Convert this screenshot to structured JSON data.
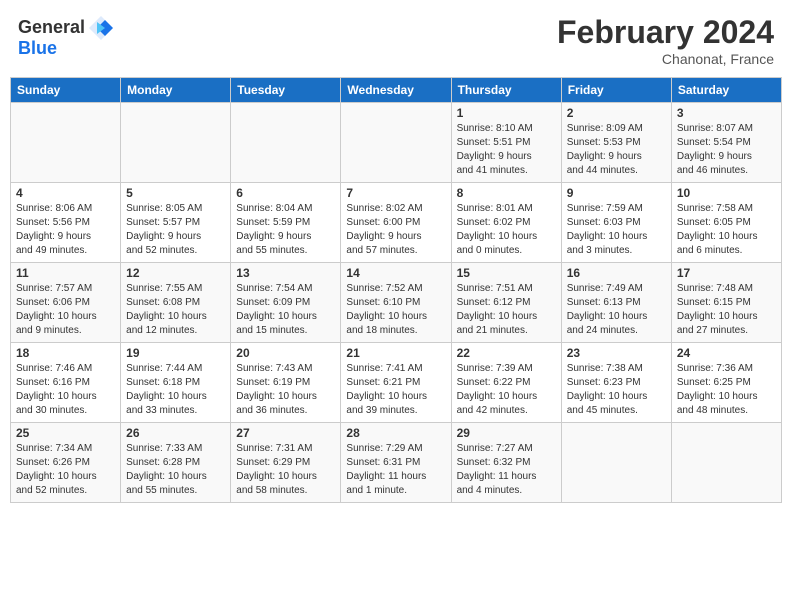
{
  "header": {
    "logo_line1": "General",
    "logo_line2": "Blue",
    "month_title": "February 2024",
    "location": "Chanonat, France"
  },
  "days_of_week": [
    "Sunday",
    "Monday",
    "Tuesday",
    "Wednesday",
    "Thursday",
    "Friday",
    "Saturday"
  ],
  "weeks": [
    [
      {
        "day": "",
        "info": ""
      },
      {
        "day": "",
        "info": ""
      },
      {
        "day": "",
        "info": ""
      },
      {
        "day": "",
        "info": ""
      },
      {
        "day": "1",
        "info": "Sunrise: 8:10 AM\nSunset: 5:51 PM\nDaylight: 9 hours\nand 41 minutes."
      },
      {
        "day": "2",
        "info": "Sunrise: 8:09 AM\nSunset: 5:53 PM\nDaylight: 9 hours\nand 44 minutes."
      },
      {
        "day": "3",
        "info": "Sunrise: 8:07 AM\nSunset: 5:54 PM\nDaylight: 9 hours\nand 46 minutes."
      }
    ],
    [
      {
        "day": "4",
        "info": "Sunrise: 8:06 AM\nSunset: 5:56 PM\nDaylight: 9 hours\nand 49 minutes."
      },
      {
        "day": "5",
        "info": "Sunrise: 8:05 AM\nSunset: 5:57 PM\nDaylight: 9 hours\nand 52 minutes."
      },
      {
        "day": "6",
        "info": "Sunrise: 8:04 AM\nSunset: 5:59 PM\nDaylight: 9 hours\nand 55 minutes."
      },
      {
        "day": "7",
        "info": "Sunrise: 8:02 AM\nSunset: 6:00 PM\nDaylight: 9 hours\nand 57 minutes."
      },
      {
        "day": "8",
        "info": "Sunrise: 8:01 AM\nSunset: 6:02 PM\nDaylight: 10 hours\nand 0 minutes."
      },
      {
        "day": "9",
        "info": "Sunrise: 7:59 AM\nSunset: 6:03 PM\nDaylight: 10 hours\nand 3 minutes."
      },
      {
        "day": "10",
        "info": "Sunrise: 7:58 AM\nSunset: 6:05 PM\nDaylight: 10 hours\nand 6 minutes."
      }
    ],
    [
      {
        "day": "11",
        "info": "Sunrise: 7:57 AM\nSunset: 6:06 PM\nDaylight: 10 hours\nand 9 minutes."
      },
      {
        "day": "12",
        "info": "Sunrise: 7:55 AM\nSunset: 6:08 PM\nDaylight: 10 hours\nand 12 minutes."
      },
      {
        "day": "13",
        "info": "Sunrise: 7:54 AM\nSunset: 6:09 PM\nDaylight: 10 hours\nand 15 minutes."
      },
      {
        "day": "14",
        "info": "Sunrise: 7:52 AM\nSunset: 6:10 PM\nDaylight: 10 hours\nand 18 minutes."
      },
      {
        "day": "15",
        "info": "Sunrise: 7:51 AM\nSunset: 6:12 PM\nDaylight: 10 hours\nand 21 minutes."
      },
      {
        "day": "16",
        "info": "Sunrise: 7:49 AM\nSunset: 6:13 PM\nDaylight: 10 hours\nand 24 minutes."
      },
      {
        "day": "17",
        "info": "Sunrise: 7:48 AM\nSunset: 6:15 PM\nDaylight: 10 hours\nand 27 minutes."
      }
    ],
    [
      {
        "day": "18",
        "info": "Sunrise: 7:46 AM\nSunset: 6:16 PM\nDaylight: 10 hours\nand 30 minutes."
      },
      {
        "day": "19",
        "info": "Sunrise: 7:44 AM\nSunset: 6:18 PM\nDaylight: 10 hours\nand 33 minutes."
      },
      {
        "day": "20",
        "info": "Sunrise: 7:43 AM\nSunset: 6:19 PM\nDaylight: 10 hours\nand 36 minutes."
      },
      {
        "day": "21",
        "info": "Sunrise: 7:41 AM\nSunset: 6:21 PM\nDaylight: 10 hours\nand 39 minutes."
      },
      {
        "day": "22",
        "info": "Sunrise: 7:39 AM\nSunset: 6:22 PM\nDaylight: 10 hours\nand 42 minutes."
      },
      {
        "day": "23",
        "info": "Sunrise: 7:38 AM\nSunset: 6:23 PM\nDaylight: 10 hours\nand 45 minutes."
      },
      {
        "day": "24",
        "info": "Sunrise: 7:36 AM\nSunset: 6:25 PM\nDaylight: 10 hours\nand 48 minutes."
      }
    ],
    [
      {
        "day": "25",
        "info": "Sunrise: 7:34 AM\nSunset: 6:26 PM\nDaylight: 10 hours\nand 52 minutes."
      },
      {
        "day": "26",
        "info": "Sunrise: 7:33 AM\nSunset: 6:28 PM\nDaylight: 10 hours\nand 55 minutes."
      },
      {
        "day": "27",
        "info": "Sunrise: 7:31 AM\nSunset: 6:29 PM\nDaylight: 10 hours\nand 58 minutes."
      },
      {
        "day": "28",
        "info": "Sunrise: 7:29 AM\nSunset: 6:31 PM\nDaylight: 11 hours\nand 1 minute."
      },
      {
        "day": "29",
        "info": "Sunrise: 7:27 AM\nSunset: 6:32 PM\nDaylight: 11 hours\nand 4 minutes."
      },
      {
        "day": "",
        "info": ""
      },
      {
        "day": "",
        "info": ""
      }
    ]
  ]
}
